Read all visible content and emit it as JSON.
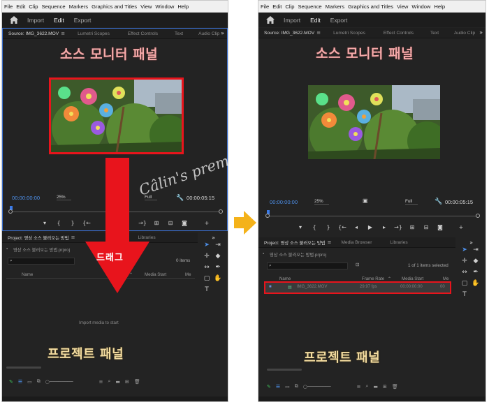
{
  "menu": [
    "File",
    "Edit",
    "Clip",
    "Sequence",
    "Markers",
    "Graphics and Titles",
    "View",
    "Window",
    "Help"
  ],
  "workspaces": [
    "Import",
    "Edit",
    "Export"
  ],
  "monitor_tabs": {
    "source": "Source: IMG_3622.MOV",
    "lumetri": "Lumetri Scopes",
    "effects": "Effect Controls",
    "text": "Text",
    "audio": "Audio Clip"
  },
  "labels": {
    "source_monitor": "소스 모니터 패널",
    "project_panel": "프로젝트 패널",
    "drag": "드래그",
    "watermark": "Câlin's premiere pro tutorial"
  },
  "monitor": {
    "timecode_in": "00:00:00:00",
    "zoom": "25%",
    "resolution": "Full",
    "timecode_out": "00:00:05:15"
  },
  "project_tabs": {
    "left_title": "Project: 영상 소스 불러오는 방법",
    "right_title": "Project: 영상 소스 불러오는 방법",
    "media_browser": "Media Browser",
    "libraries": "Libraries"
  },
  "project": {
    "bin_left": "영상 소스 불러오는 방법.prproj",
    "bin_right": "영상 소스 불러오는 방법.prproj",
    "items_left": "0 items",
    "items_right": "1 of 1 items selected",
    "col_name": "Name",
    "col_frame_rate": "Frame Rate",
    "col_media_start": "Media Start",
    "col_media_end": "Me",
    "empty_message": "Import media to start",
    "file": {
      "name": "IMG_3622.MOV",
      "frame_rate": "29.97 fps",
      "media_start": "00:00:00:00",
      "media_end": "00"
    }
  },
  "icons": [
    "home-icon",
    "wrench-icon",
    "camera-icon",
    "search-icon",
    "selection-tool-icon",
    "hand-tool-icon",
    "type-tool-icon",
    "pen-tool-icon"
  ],
  "colors": {
    "highlight_red": "#e8141c",
    "accent_blue": "#4d8fe8",
    "arrow_orange": "#f4b21a",
    "label_pink": "#f5a9a9",
    "label_yellow": "#f3dca0"
  }
}
